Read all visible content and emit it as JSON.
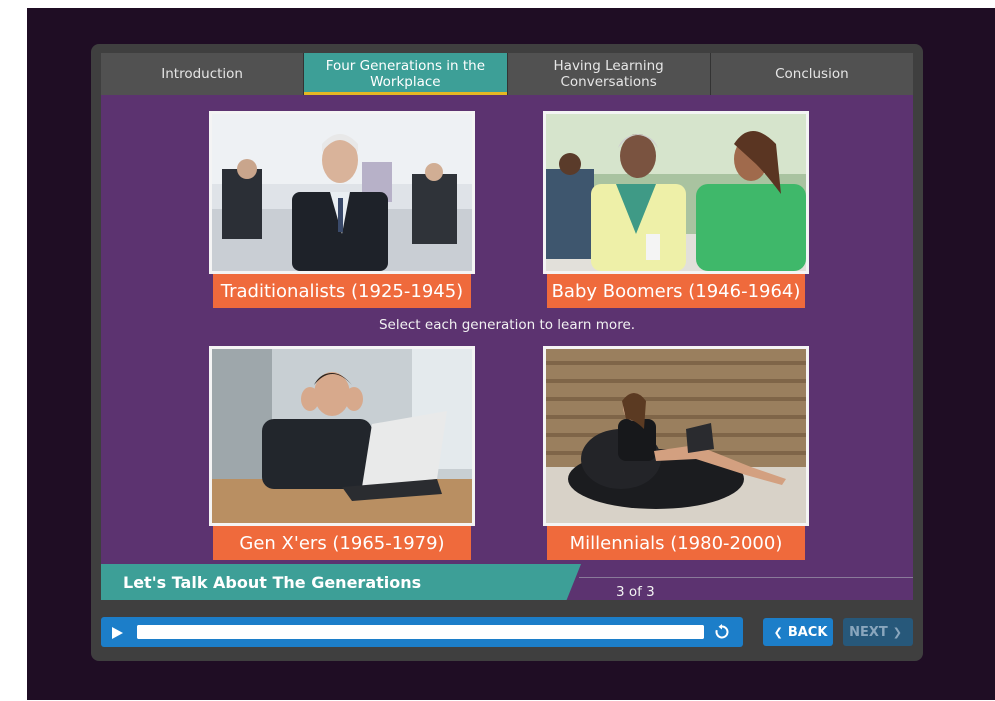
{
  "tabs": [
    {
      "label": "Introduction",
      "active": false
    },
    {
      "label": "Four Generations in the Workplace",
      "active": true
    },
    {
      "label": "Having Learning Conversations",
      "active": false
    },
    {
      "label": "Conclusion",
      "active": false
    }
  ],
  "generations": [
    {
      "label": "Traditionalists (1925-1945)",
      "photo": "man-in-suit-office-photo"
    },
    {
      "label": "Baby Boomers (1946-1964)",
      "photo": "women-talking-cafe-photo"
    },
    {
      "label": "Gen X'ers (1965-1979)",
      "photo": "stressed-man-laptop-photo"
    },
    {
      "label": "Millennials (1980-2000)",
      "photo": "woman-beanbag-laptop-photo"
    }
  ],
  "instruction": "Select each generation to learn more.",
  "slide": {
    "title": "Let's Talk About The Generations",
    "counter": "3 of 3"
  },
  "controls": {
    "back_label": "BACK",
    "next_label": "NEXT",
    "progress": 1.0
  },
  "colors": {
    "content_bg": "#5c3370",
    "accent_teal": "#3d9f97",
    "label_orange": "#ef6a3c",
    "control_blue": "#1c7ec9"
  }
}
